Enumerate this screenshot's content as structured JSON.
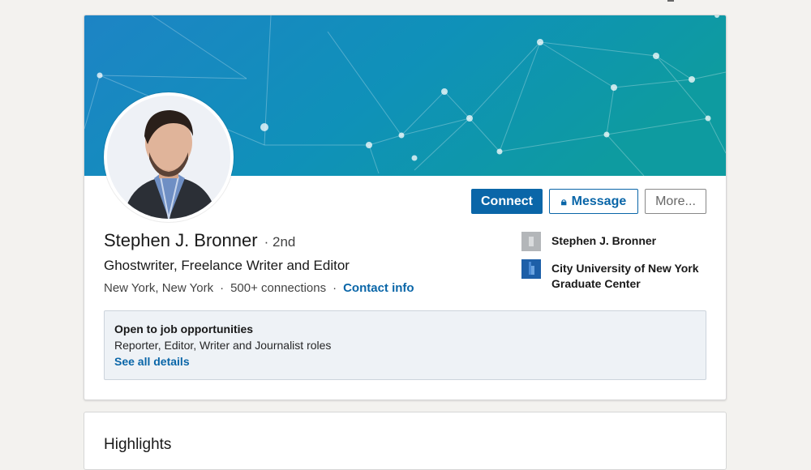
{
  "profile": {
    "name": "Stephen J. Bronner",
    "degree_separator": "·",
    "degree": "2nd",
    "headline": "Ghostwriter, Freelance Writer and Editor",
    "location": "New York, New York",
    "dot": "·",
    "connections": "500+ connections",
    "contact_info": "Contact info"
  },
  "actions": {
    "connect": "Connect",
    "message": "Message",
    "more": "More..."
  },
  "orgs": [
    {
      "name": "Stephen J. Bronner",
      "icon": "company-icon"
    },
    {
      "name": "City University of New York Graduate Center",
      "icon": "school-logo-icon"
    }
  ],
  "open_to_work": {
    "title": "Open to job opportunities",
    "roles": "Reporter, Editor, Writer and Journalist roles",
    "link": "See all details"
  },
  "highlights": {
    "title": "Highlights"
  },
  "colors": {
    "accent": "#0a66a8",
    "banner_left": "#1e87c4",
    "banner_right": "#0e9aa0"
  }
}
